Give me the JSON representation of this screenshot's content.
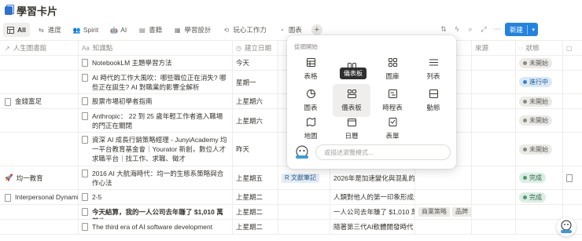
{
  "page": {
    "title": "學習卡片"
  },
  "views": [
    {
      "label": "All",
      "icon": "table-icon",
      "active": true
    },
    {
      "label": "進度",
      "icon": "arrow-icon"
    },
    {
      "label": "Spirit",
      "icon": "people-icon"
    },
    {
      "label": "AI",
      "icon": "robot-icon"
    },
    {
      "label": "書籍",
      "icon": "book-icon"
    },
    {
      "label": "學習設計",
      "icon": "design-icon"
    },
    {
      "label": "玩心工作力",
      "icon": "flow-icon"
    },
    {
      "label": "圖表",
      "icon": "chart-icon"
    }
  ],
  "toolbar": {
    "new_label": "新建"
  },
  "table": {
    "headers": [
      "人生圖書館",
      "知識點",
      "建立日期",
      "",
      "",
      "",
      "來源",
      "狀態",
      ""
    ],
    "rows": [
      {
        "library": "",
        "title": "NotebookLM 主題學習方法",
        "bold": false,
        "date": "今天",
        "tag": "",
        "note": "",
        "status": "未開始",
        "status_kind": "gray"
      },
      {
        "library": "",
        "title": "AI 時代的工作大風吹：哪些職位正在消失? 哪些正在誕生? AI 對職業的影響全解析",
        "bold": false,
        "date": "星期一",
        "tag": "",
        "note": "",
        "status": "進行中",
        "status_kind": "blue"
      },
      {
        "library": "金錢富足",
        "title": "股票市場初學者指南",
        "bold": false,
        "date": "上星期六",
        "tag": "",
        "note": "",
        "status": "未開始",
        "status_kind": "gray"
      },
      {
        "library": "",
        "title": "Anthropic： 22 到 25 歲年輕工作者進入職場的門正在關閉",
        "bold": false,
        "date": "上星期六",
        "tag": "",
        "note": "",
        "status": "未開始",
        "status_kind": "gray"
      },
      {
        "library": "",
        "title": "資深 AI 成長行銷策略經理 - JunyiAcademy 均一平台教育基金會｜Yourator 新創，數位人才求職平台｜找工作、求職、徵才",
        "bold": false,
        "date": "昨天",
        "tag": "",
        "note": "",
        "status": "未開始",
        "status_kind": "gray"
      },
      {
        "library": "均一教育",
        "title": "2016 AI 大航海時代：均一的生態系策略與合作心法",
        "bold": false,
        "date": "上星期五",
        "tag": "R 文獻筆記",
        "note": "2026年是加速變化與混亂的一",
        "status": "完成",
        "status_kind": "green"
      },
      {
        "library": "Interpersonal Dynami",
        "title": "2-5",
        "bold": false,
        "date": "上星期二",
        "tag": "",
        "note": "人類對他人的第一印象形成速度",
        "status": "完成",
        "status_kind": "green"
      },
      {
        "library": "",
        "title": "今天結算，我的一人公司去年賺了 $1,010 萬營收",
        "bold": true,
        "date": "上星期二",
        "tag": "",
        "note": "一人公司去年賺了 $1,010 萬",
        "tags2": [
          "商業策略",
          "品牌"
        ],
        "status": "",
        "status_kind": ""
      },
      {
        "library": "",
        "title": "The third era of AI software development",
        "bold": false,
        "date": "上星期二",
        "tag": "",
        "note": "隨著第三代AI軟體開發時代",
        "status": "",
        "status_kind": ""
      }
    ]
  },
  "popup": {
    "heading": "從頭開始",
    "items": [
      {
        "label": "表格",
        "icon": "table-icon"
      },
      {
        "label": "",
        "icon": "board-icon",
        "tooltip": "儀表板"
      },
      {
        "label": "圖庫",
        "icon": "gallery-icon"
      },
      {
        "label": "列表",
        "icon": "list-icon"
      },
      {
        "label": "圖表",
        "icon": "chart-icon"
      },
      {
        "label": "儀表板",
        "icon": "dashboard-icon"
      },
      {
        "label": "時程表",
        "icon": "timeline-icon"
      },
      {
        "label": "動態",
        "icon": "feed-icon"
      },
      {
        "label": "地圖",
        "icon": "map-icon"
      },
      {
        "label": "日曆",
        "icon": "calendar-icon"
      },
      {
        "label": "表單",
        "icon": "form-icon"
      }
    ],
    "input_placeholder": "或描述瀏覽模式..."
  }
}
